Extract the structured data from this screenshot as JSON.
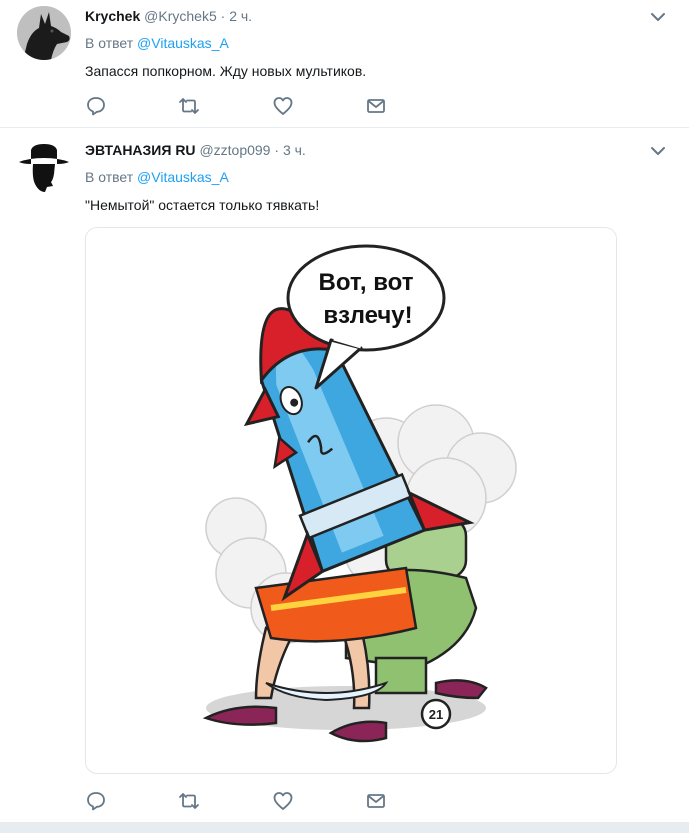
{
  "tweets": [
    {
      "name": "Krychek",
      "handle": "@Krychek5",
      "separator": "·",
      "time": "2 ч.",
      "reply_prefix": "В ответ",
      "reply_to": "@Vitauskas_A",
      "text": "Запасся попкорном. Жду новых мультиков.",
      "avatar_icon": "dog-avatar-icon"
    },
    {
      "name": "ЭВТАНАЗИЯ RU",
      "handle": "@zztop099",
      "separator": "·",
      "time": "3 ч.",
      "reply_prefix": "В ответ",
      "reply_to": "@Vitauskas_A",
      "text": "\"Немытой\" остается только тявкать!",
      "avatar_icon": "hat-silhouette-avatar-icon",
      "image": {
        "bubble_line1": "Вот, вот",
        "bubble_line2": "взлечу!",
        "stamp": "21"
      }
    }
  ],
  "action_icons": [
    "reply-icon",
    "retweet-icon",
    "like-icon",
    "direct-message-icon"
  ],
  "colors": {
    "link": "#1da1f2",
    "muted": "#657786",
    "text": "#14171a",
    "border": "#e6ecf0"
  }
}
